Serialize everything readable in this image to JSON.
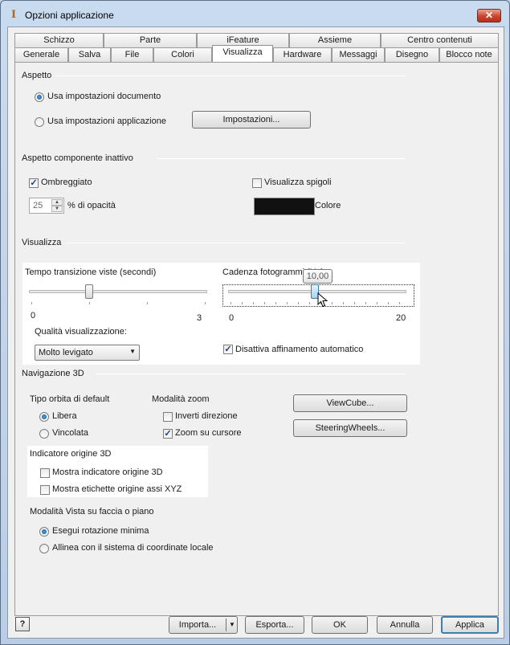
{
  "window": {
    "title": "Opzioni applicazione",
    "close_glyph": "✕"
  },
  "tabs_row1": [
    "Schizzo",
    "Parte",
    "iFeature",
    "Assieme",
    "Centro contenuti"
  ],
  "tabs_row2": [
    "Generale",
    "Salva",
    "File",
    "Colori",
    "Visualizza",
    "Hardware",
    "Messaggi",
    "Disegno",
    "Blocco note"
  ],
  "active_tab": "Visualizza",
  "aspetto": {
    "label": "Aspetto",
    "opt_documento": "Usa impostazioni documento",
    "opt_applicazione": "Usa impostazioni applicazione",
    "selected": "documento",
    "impostazioni_button": "Impostazioni..."
  },
  "inattivo": {
    "label": "Aspetto componente inattivo",
    "ombreggiato": "Ombreggiato",
    "ombreggiato_checked": true,
    "opacita_value": "25",
    "opacita_label": "% di opacità",
    "spigoli": "Visualizza spigoli",
    "spigoli_checked": false,
    "colore_label": "Colore",
    "colore_value": "#111111"
  },
  "visualizza": {
    "label": "Visualizza",
    "tempo_label": "Tempo transizione viste (secondi)",
    "tempo_min": "0",
    "tempo_max": "3",
    "tempo_value": 1,
    "cadenza_label": "Cadenza fotogrammi (Hz)",
    "cadenza_min": "0",
    "cadenza_max": "20",
    "cadenza_value": 10,
    "cadenza_tooltip": "10,00",
    "qualita_label": "Qualità visualizzazione:",
    "qualita_value": "Molto levigato",
    "affinamento": "Disattiva affinamento automatico",
    "affinamento_checked": true
  },
  "nav3d": {
    "label": "Navigazione 3D",
    "orbita_label": "Tipo orbita di default",
    "libera": "Libera",
    "vincolata": "Vincolata",
    "orbita_selected": "libera",
    "zoom_label": "Modalità zoom",
    "inverti": "Inverti direzione",
    "inverti_checked": false,
    "zoom_cursore": "Zoom su cursore",
    "zoom_cursore_checked": true,
    "viewcube_button": "ViewCube...",
    "steering_button": "SteeringWheels..."
  },
  "origine": {
    "label": "Indicatore origine 3D",
    "mostra_indicatore": "Mostra indicatore origine 3D",
    "mostra_etichette": "Mostra etichette origine assi XYZ"
  },
  "faccia": {
    "label": "Modalità Vista su faccia o piano",
    "rotazione_minima": "Esegui rotazione minima",
    "allinea": "Allinea con il sistema di coordinate locale",
    "selected": "rotazione"
  },
  "footer": {
    "help": "?",
    "importa": "Importa...",
    "esporta": "Esporta...",
    "ok": "OK",
    "annulla": "Annulla",
    "applica": "Applica"
  }
}
